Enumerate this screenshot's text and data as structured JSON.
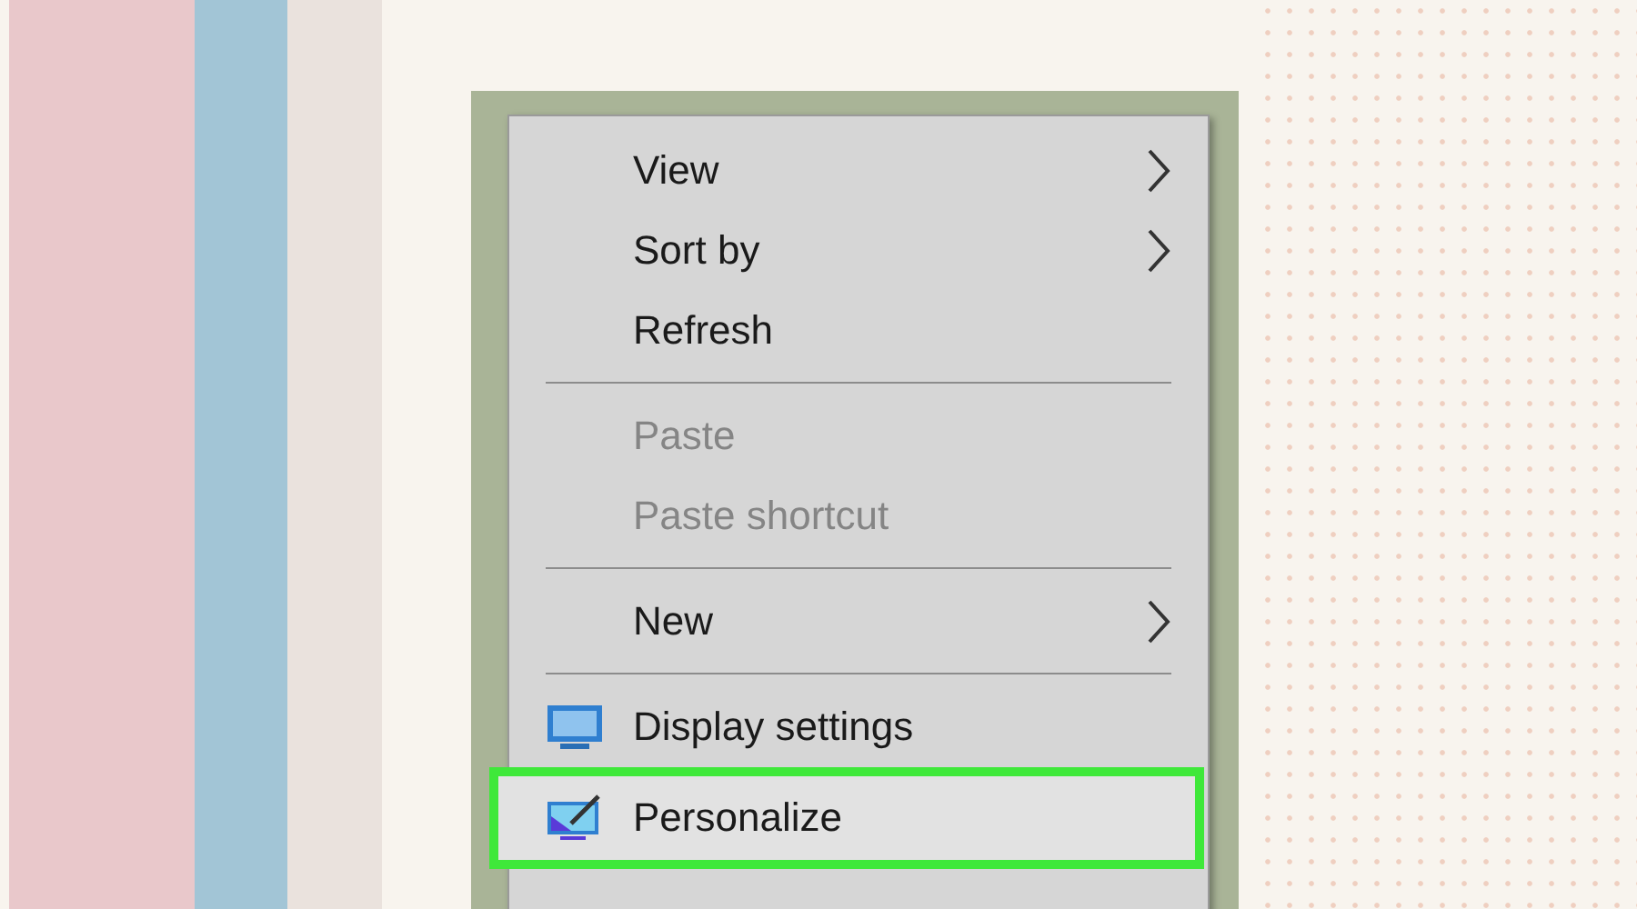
{
  "context_menu": {
    "items": [
      {
        "kind": "item",
        "label": "View",
        "disabled": false,
        "submenu": true,
        "selected": false,
        "highlighted": false
      },
      {
        "kind": "item",
        "label": "Sort by",
        "disabled": false,
        "submenu": true,
        "selected": false,
        "highlighted": false
      },
      {
        "kind": "item",
        "label": "Refresh",
        "disabled": false,
        "submenu": false,
        "selected": false,
        "highlighted": false
      },
      {
        "kind": "separator"
      },
      {
        "kind": "item",
        "label": "Paste",
        "disabled": true,
        "submenu": false,
        "selected": false,
        "highlighted": false
      },
      {
        "kind": "item",
        "label": "Paste shortcut",
        "disabled": true,
        "submenu": false,
        "selected": false,
        "highlighted": false
      },
      {
        "kind": "separator"
      },
      {
        "kind": "item",
        "label": "New",
        "disabled": false,
        "submenu": true,
        "selected": false,
        "highlighted": false
      },
      {
        "kind": "separator"
      },
      {
        "kind": "monitor",
        "label": "Display settings",
        "disabled": false,
        "submenu": false,
        "selected": false,
        "highlighted": false
      },
      {
        "kind": "customize",
        "label": "Personalize",
        "disabled": false,
        "submenu": false,
        "selected": true,
        "highlighted": true
      }
    ]
  }
}
